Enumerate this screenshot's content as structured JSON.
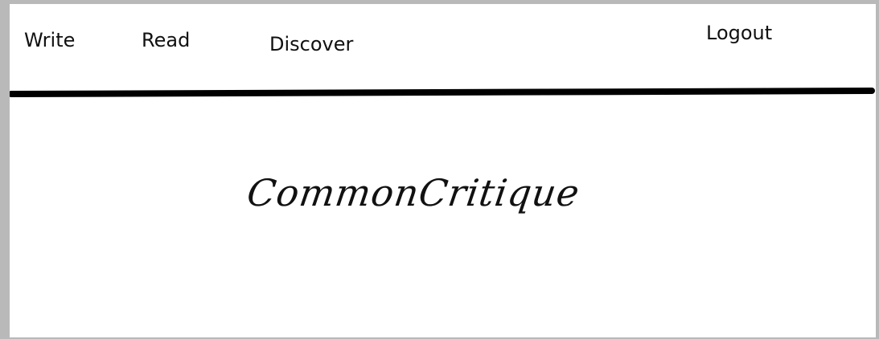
{
  "nav": {
    "write_label": "Write",
    "read_label": "Read",
    "discover_label": "Discover",
    "logout_label": "Logout"
  },
  "brand": {
    "title": "CommonCritique"
  },
  "colors": {
    "background": "#ffffff",
    "text": "#111111",
    "divider": "#000000",
    "outer": "#b9b9b9"
  }
}
